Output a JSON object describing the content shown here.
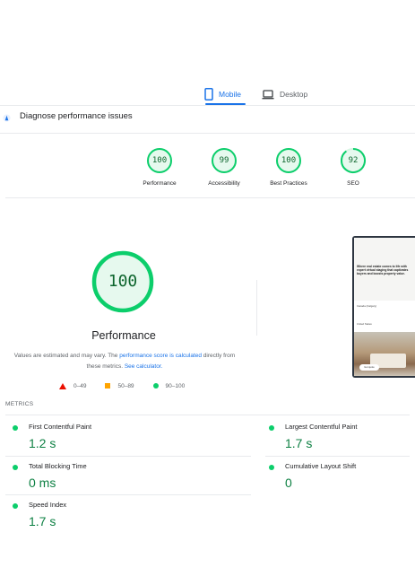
{
  "tabs": {
    "mobile": "Mobile",
    "desktop": "Desktop"
  },
  "diagnose": {
    "title": "Diagnose performance issues"
  },
  "categories": [
    {
      "score": "100",
      "label": "Performance"
    },
    {
      "score": "99",
      "label": "Accessibility"
    },
    {
      "score": "100",
      "label": "Best Practices"
    },
    {
      "score": "92",
      "label": "SEO"
    }
  ],
  "summary": {
    "score": "100",
    "title": "Performance",
    "note_prefix": "Values are estimated and may vary. The ",
    "note_link1": "performance score is calculated",
    "note_middle": " directly from these metrics. ",
    "note_link2": "See calculator."
  },
  "legend": {
    "fail": "0–49",
    "average": "50–89",
    "pass": "90–100"
  },
  "thumbnail": {
    "headline": "Where real estate comes to life with expert virtual staging that captivates buyers and boosts property value.",
    "line1": "Canada (Calgary)",
    "line2": "United States",
    "button": "Get quote"
  },
  "metrics": {
    "heading": "METRICS",
    "items": [
      {
        "name": "First Contentful Paint",
        "value": "1.2 s"
      },
      {
        "name": "Largest Contentful Paint",
        "value": "1.7 s"
      },
      {
        "name": "Total Blocking Time",
        "value": "0 ms"
      },
      {
        "name": "Cumulative Layout Shift",
        "value": "0"
      },
      {
        "name": "Speed Index",
        "value": "1.7 s"
      }
    ]
  },
  "colors": {
    "accent": "#1a73e8",
    "pass": "#0cce6b",
    "pass_text": "#0d652d",
    "average": "#ffa400",
    "fail": "#eb0f00"
  },
  "icons": {
    "mobile": "smartphone-icon",
    "desktop": "laptop-icon",
    "diagnose": "lighthouse-icon"
  }
}
